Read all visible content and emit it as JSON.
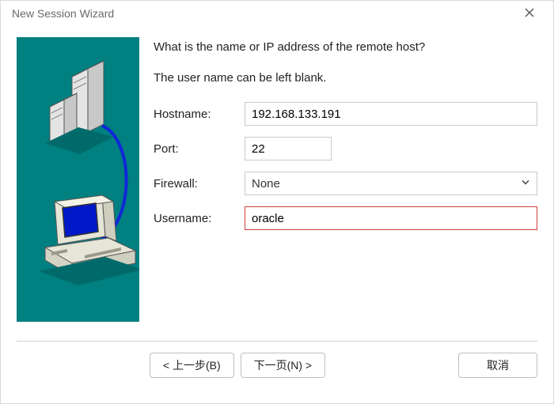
{
  "window": {
    "title": "New Session Wizard"
  },
  "prompts": {
    "line1": "What is the name or IP address of the remote host?",
    "line2": "The user name can be left blank."
  },
  "fields": {
    "hostname": {
      "label": "Hostname:",
      "value": "192.168.133.191"
    },
    "port": {
      "label": "Port:",
      "value": "22"
    },
    "firewall": {
      "label": "Firewall:",
      "value": "None"
    },
    "username": {
      "label": "Username:",
      "value": "oracle"
    }
  },
  "buttons": {
    "back": "< 上一步(B)",
    "next": "下一页(N) >",
    "cancel": "取消"
  }
}
